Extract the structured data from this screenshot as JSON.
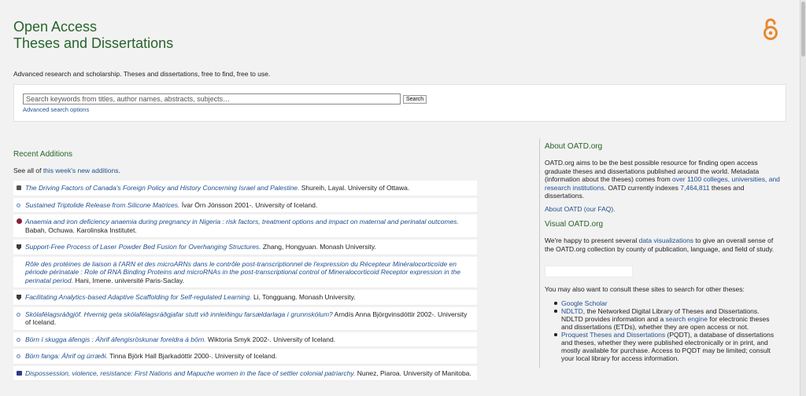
{
  "site": {
    "title_line1": "Open Access",
    "title_line2": "Theses and Dissertations",
    "tagline": "Advanced research and scholarship. Theses and dissertations, free to find, free to use.",
    "accent_color": "#27632a",
    "logo_color": "#e8892c"
  },
  "search": {
    "placeholder": "Search keywords from titles, author names, abstracts, subjects…",
    "button_label": "Search",
    "advanced_link": "Advanced search options"
  },
  "recent": {
    "heading": "Recent Additions",
    "seeall_prefix": "See all of ",
    "seeall_link": "this week's new additions",
    "seeall_suffix": ".",
    "items": [
      {
        "icon": "crest",
        "title": "The Driving Factors of Canada's Foreign Policy and History Concerning Israel and Palestine.",
        "rest": " Shureih, Layal. University of Ottawa."
      },
      {
        "icon": "dot",
        "title": "Sustained Triptolide Release from Silicone Matrices.",
        "rest": " Ívar Örn Jónsson 2001-. University of Iceland."
      },
      {
        "icon": "wine",
        "title": "Anaemia and iron deficiency anaemia during pregnancy in Nigeria : risk factors, treatment options and impact on maternal and perinatal outcomes.",
        "rest": " Babah, Ochuwa. Karolinska Institutet."
      },
      {
        "icon": "shield",
        "title": "Support-Free Process of Laser Powder Bed Fusion for Overhanging Structures.",
        "rest": " Zhang, Hongyuan. Monash University."
      },
      {
        "icon": "none",
        "title": "Rôle des protéines de liaison à l'ARN et des microARNs dans le contrôle post-transcriptionnel de l'expression du Récepteur Minéralocorticoïde en période périnatale : Role of RNA Binding Proteins and microRNAs in the post-transcriptional control of Mineralocorticoid Receptor expression in the perinatal period.",
        "rest": " Hani, Imene. université Paris-Saclay."
      },
      {
        "icon": "shield",
        "title": "Facilitating Analytics-based Adaptive Scaffolding for Self-regulated Learning.",
        "rest": " Li, Tongguang. Monash University."
      },
      {
        "icon": "dot",
        "title": "Skólafélagsráðgjöf. Hvernig geta skólafélagsráðgjafar stutt við innleiðingu farsældarlaga í grunnskólum?",
        "rest": " Arndís Anna Björgvinsdóttir 2002-. University of Iceland."
      },
      {
        "icon": "dot",
        "title": "Börn í skugga áfengis : Áhrif áfengisröskunar foreldra á börn.",
        "rest": " Wiktoria Smyk 2002-. University of Iceland."
      },
      {
        "icon": "dot",
        "title": "Börn fanga: Áhrif og úrræði.",
        "rest": " Tinna Björk Hall Bjarkadóttir 2000-. University of Iceland."
      },
      {
        "icon": "bookish",
        "title": "Dispossession, violence, resistance: First Nations and Mapuche women in the face of settler colonial patriarchy.",
        "rest": " Nunez, Piaroa. University of Manitoba."
      }
    ]
  },
  "about": {
    "heading": "About OATD.org",
    "text1": "OATD.org aims to be the best possible resource for finding open access graduate theses and dissertations published around the world. Metadata (information about the theses) comes from ",
    "link1": "over 1100 colleges, universities, and research institutions",
    "text2": ". OATD currently indexes ",
    "link2": "7,464,811",
    "text3": " theses and dissertations.",
    "faq_prefix": "About OATD (",
    "faq_link": "our FAQ",
    "faq_suffix": ")."
  },
  "visual": {
    "heading": "Visual OATD.org",
    "text1": "We're happy to present several ",
    "link": "data visualizations",
    "text2": " to give an overall sense of the OATD.org collection by county of publication, language, and field of study."
  },
  "consult": {
    "intro": "You may also want to consult these sites to search for other theses:",
    "google": "Google Scholar",
    "ndltd_link": "NDLTD",
    "ndltd_text1": ", the Networked Digital Library of Theses and Dissertations. NDLTD provides information and a ",
    "ndltd_link2": "search engine",
    "ndltd_text2": " for electronic theses and dissertations (ETDs), whether they are open access or not.",
    "pqdt_link": "Proquest Theses and Dissertations",
    "pqdt_text": " (PQDT), a database of dissertations and theses, whether they were published electronically or in print, and mostly available for purchase. Access to PQDT may be limited; consult your local library for access information."
  }
}
